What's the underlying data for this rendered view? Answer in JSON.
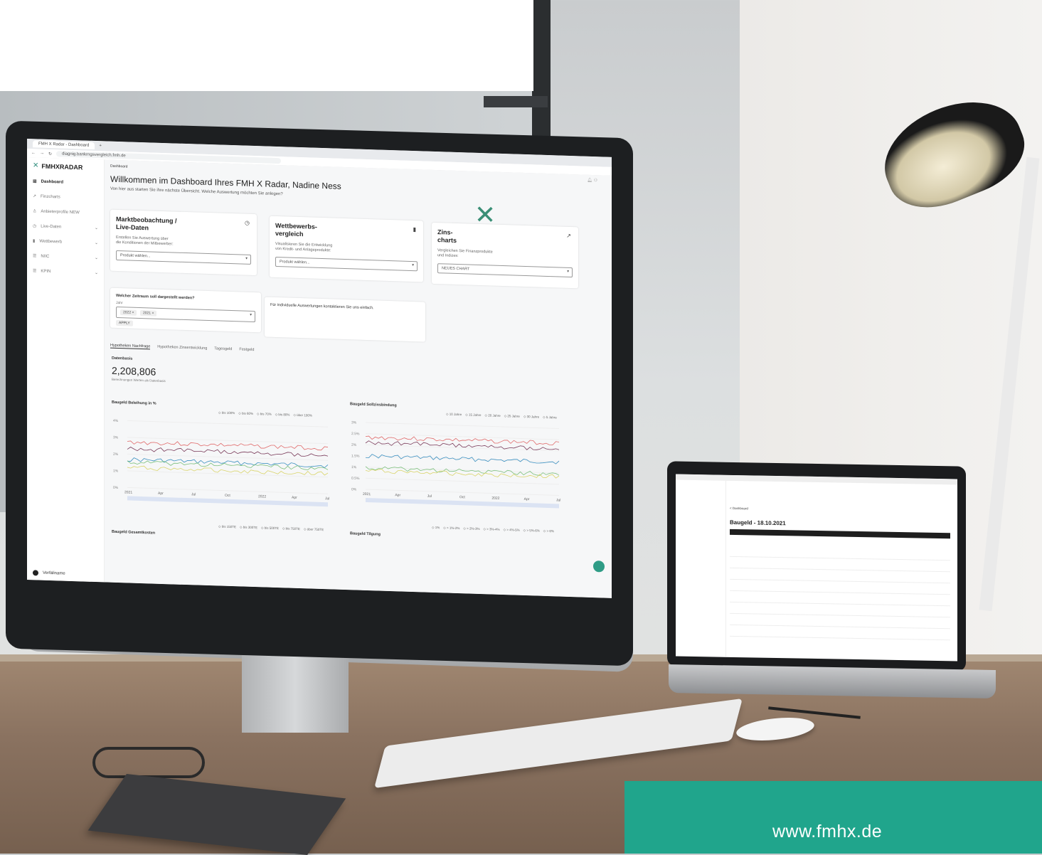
{
  "browser": {
    "tab_title": "FMH X Radar - Dashboard",
    "url": "diagnig.bankrngsvergleich.fmh.de"
  },
  "sidebar": {
    "logo": "FMHXRADAR",
    "items": [
      {
        "label": "Dashboard"
      },
      {
        "label": "Finzcharts"
      },
      {
        "label": "Anbieterprofile NEW"
      },
      {
        "label": "Live-Daten"
      },
      {
        "label": "Wettbewerb"
      },
      {
        "label": "NIIC"
      },
      {
        "label": "KPIN"
      }
    ],
    "user": "Verfäliname"
  },
  "main": {
    "breadcrumb": "Dashboard",
    "welcome": "Willkommen im Dashboard Ihres FMH X Radar, Nadine Ness",
    "subtitle": "Von hier aus starten Sie ihre nächste Übersicht. Welche Auswertung möchten Sie anlegen?"
  },
  "cards": [
    {
      "title1": "Marktbeobachtung /",
      "title2": "Live-Daten",
      "desc1": "Erstellen Sie Auswertung über",
      "desc2": "die Konditionen der Mitbewerber:",
      "select": "Produkt wählen..."
    },
    {
      "title1": "Wettbewerbs-",
      "title2": "vergleich",
      "desc1": "Visualisieren Sie die Entwicklung",
      "desc2": "von Kredit- und Anlageprodukte:",
      "select": "Produkt wählen..."
    },
    {
      "title1": "Zins-",
      "title2": "charts",
      "desc1": "Vergleichen Sie Finanzprodukte",
      "desc2": "und Indizes:",
      "select": "NEUES CHART"
    }
  ],
  "filter": {
    "title": "Welcher Zeitraum soll dargestellt werden?",
    "label": "Jahr",
    "chips": [
      "2022 ×",
      "2021 ×"
    ],
    "apply": "APPLY",
    "contact": "Für individuelle Auswertungen kontaktieren Sie uns einfach."
  },
  "tabs": [
    "Hypotheken Nachfrage",
    "Hypotheken Zinsentwicklung",
    "Tagesgeld",
    "Festgeld"
  ],
  "kpi": {
    "label": "Datenbasis",
    "value": "2,208,806",
    "sub": "Berechnungen Werten als Datenbasis"
  },
  "charts": {
    "left_title": "Baugeld Beleihung in %",
    "left_legend": [
      "bis 100%",
      "bis 60%",
      "bis 70%",
      "bis 80%",
      "über 100%"
    ],
    "right_title": "Baugeld Sollzinsbindung",
    "right_legend": [
      "10 Jahre",
      "15 Jahre",
      "20 Jahre",
      "25 Jahre",
      "30 Jahre",
      "5 Jahre"
    ],
    "x_ticks": [
      "2021",
      "Apr",
      "Jul",
      "Oct",
      "2022",
      "Apr",
      "Jul"
    ],
    "left_y_ticks": [
      "4%",
      "3%",
      "2%",
      "1%",
      "0%"
    ],
    "right_y_ticks": [
      "3%",
      "2.5%",
      "2%",
      "1.5%",
      "1%",
      "0.5%",
      "0%"
    ],
    "bottom_left_title": "Baugeld Gesamtkosten",
    "bottom_left_legend": [
      "bis 150TE",
      "bis 300TE",
      "bis 500TE",
      "bis 750TE",
      "über 750TE"
    ],
    "bottom_right_title": "Baugeld Tilgung",
    "bottom_right_legend": [
      "1%",
      "> 1%-2%",
      "> 2%-3%",
      "> 3%-4%",
      "> 4%-5%",
      "> 5%-6%",
      "> 6%"
    ],
    "series_colors": [
      "#e06a6a",
      "#7a3b5a",
      "#3a8fc0",
      "#7cc07c",
      "#d9d46a"
    ]
  },
  "laptop": {
    "title": "Baugeld - 18.10.2021",
    "back": "< Dashboard"
  },
  "promo": {
    "url": "www.fmhx.de"
  }
}
